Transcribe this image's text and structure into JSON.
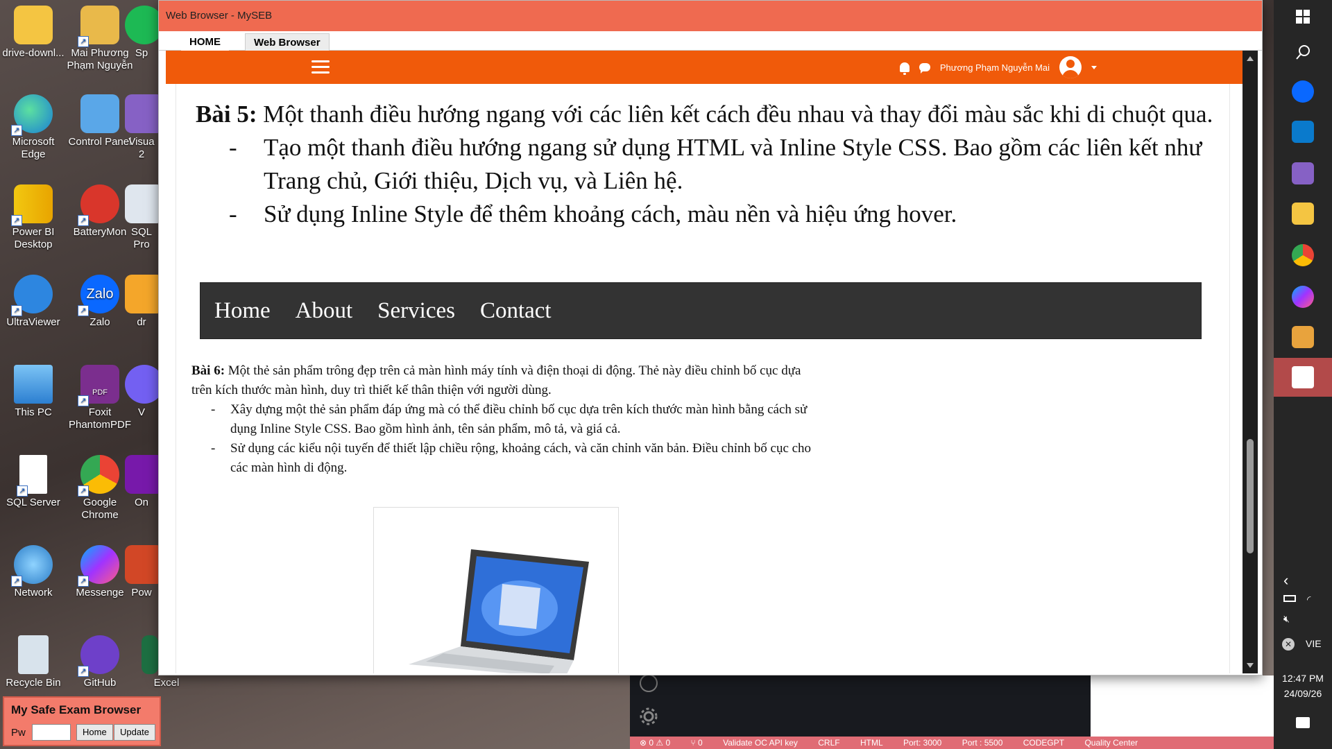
{
  "desktop": {
    "icons": [
      {
        "label": "drive-downl...",
        "icon": "folder-icon"
      },
      {
        "label": "Mai Phương Phạm Nguyễn",
        "icon": "user-folder-icon"
      },
      {
        "label": "Sp",
        "icon": "spotify-icon"
      },
      {
        "label": "Microsoft Edge",
        "icon": "edge-icon"
      },
      {
        "label": "Control Panel",
        "icon": "control-panel-icon"
      },
      {
        "label": "Visua 2",
        "icon": "visual-studio-icon"
      },
      {
        "label": "Power BI Desktop",
        "icon": "powerbi-icon"
      },
      {
        "label": "BatteryMon",
        "icon": "batterymon-icon"
      },
      {
        "label": "SQL Pro",
        "icon": "sql-profiler-icon"
      },
      {
        "label": "UltraViewer",
        "icon": "ultraviewer-icon"
      },
      {
        "label": "Zalo",
        "icon": "zalo-icon"
      },
      {
        "label": "dr",
        "icon": "drive-icon"
      },
      {
        "label": "This PC",
        "icon": "this-pc-icon"
      },
      {
        "label": "Foxit PhantomPDF",
        "icon": "foxit-icon"
      },
      {
        "label": "V",
        "icon": "viber-icon"
      },
      {
        "label": "SQL Server",
        "icon": "file-icon"
      },
      {
        "label": "Google Chrome",
        "icon": "chrome-icon"
      },
      {
        "label": "On",
        "icon": "onenote-icon"
      },
      {
        "label": "Network",
        "icon": "network-icon"
      },
      {
        "label": "Messenge",
        "icon": "messenger-icon"
      },
      {
        "label": "Pow",
        "icon": "powerpoint-icon"
      },
      {
        "label": "Recycle Bin",
        "icon": "recycle-bin-icon"
      },
      {
        "label": "GitHub",
        "icon": "github-icon"
      },
      {
        "label": "Excel",
        "icon": "excel-icon"
      }
    ]
  },
  "window": {
    "title": "Web Browser - MySEB",
    "tabs": [
      "HOME",
      "Web Browser"
    ]
  },
  "site_header": {
    "user_name": "Phương Phạm Nguyễn Mai"
  },
  "bai5": {
    "label": "Bài 5:",
    "text": " Một thanh điều hướng ngang với các liên kết cách đều nhau và thay đổi màu sắc khi di chuột qua.",
    "items": [
      "Tạo một thanh điều hướng ngang sử dụng HTML và Inline Style CSS. Bao gồm các liên kết như Trang chủ, Giới thiệu, Dịch vụ, và Liên hệ.",
      "Sử dụng Inline Style để thêm khoảng cách, màu nền và hiệu ứng hover."
    ]
  },
  "demo_nav": {
    "links": [
      "Home",
      "About",
      "Services",
      "Contact"
    ]
  },
  "bai6": {
    "label": "Bài 6:",
    "text": " Một thẻ sản phẩm trông đẹp trên cả màn hình máy tính và điện thoại di động. Thẻ này điều chỉnh bố cục dựa trên kích thước màn hình, duy trì thiết kế thân thiện với người dùng.",
    "items": [
      "Xây dựng một thẻ sản phẩm đáp ứng mà có thể điều chỉnh bố cục dựa trên kích thước màn hình bằng cách sử dụng Inline Style CSS. Bao gồm hình ảnh, tên sản phẩm, mô tả, và giá cả.",
      "Sử dụng các kiểu nội tuyến để thiết lập chiều rộng, khoảng cách, và căn chỉnh văn bản. Điều chỉnh bố cục cho các màn hình di động."
    ]
  },
  "taskbar": {
    "language": "VIE",
    "time": "12:47 PM",
    "date": "24/09/26"
  },
  "editor_status": [
    "⊗ 0 ⚠ 0",
    "⑂ 0",
    "Validate OC API key",
    "CRLF",
    "HTML",
    "Port: 3000",
    "Port : 5500",
    "CODEGPT",
    "Quality Center"
  ],
  "myseb": {
    "title": "My Safe Exam Browser",
    "pw_label": "Pw",
    "home_button": "Home",
    "update_button": "Update"
  },
  "colors": {
    "title_bar": "#ef6a50",
    "site_header": "#f05a0a",
    "demo_nav": "#333333",
    "editor_status": "#e06c75"
  }
}
